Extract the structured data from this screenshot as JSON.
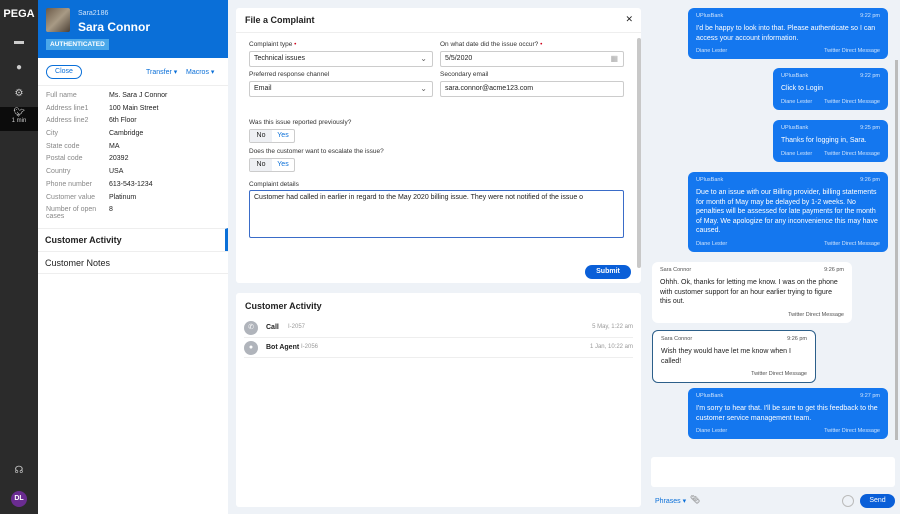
{
  "rail": {
    "logo": "PEGA",
    "active_time": "1 min",
    "avatar_initials": "DL"
  },
  "customer": {
    "handle": "Sara2186",
    "name": "Sara Connor",
    "status": "AUTHENTICATED",
    "close": "Close",
    "transfer": "Transfer",
    "macros": "Macros",
    "fields": [
      {
        "label": "Full name",
        "value": "Ms. Sara J Connor"
      },
      {
        "label": "Address line1",
        "value": "100 Main Street"
      },
      {
        "label": "Address line2",
        "value": "6th Floor"
      },
      {
        "label": "City",
        "value": "Cambridge"
      },
      {
        "label": "State code",
        "value": "MA"
      },
      {
        "label": "Postal code",
        "value": "20392"
      },
      {
        "label": "Country",
        "value": "USA"
      },
      {
        "label": "Phone number",
        "value": "613-543-1234"
      },
      {
        "label": "Customer value",
        "value": "Platinum"
      },
      {
        "label": "Number of open cases",
        "value": "8"
      }
    ],
    "tabs": [
      "Customer Activity",
      "Customer Notes"
    ]
  },
  "complaint": {
    "title": "File a Complaint",
    "type_label": "Complaint type",
    "type_value": "Technical issues",
    "date_label": "On what date did the issue occur?",
    "date_value": "5/5/2020",
    "channel_label": "Preferred response channel",
    "channel_value": "Email",
    "email_label": "Secondary email",
    "email_value": "sara.connor@acme123.com",
    "reported_label": "Was this issue reported previously?",
    "escalate_label": "Does the customer want to escalate the issue?",
    "no": "No",
    "yes": "Yes",
    "details_label": "Complaint details",
    "details_value": "Customer had called in earlier in regard to the May 2020 billing issue. They were not notified of the issue o",
    "submit": "Submit"
  },
  "activity": {
    "title": "Customer Activity",
    "items": [
      {
        "type": "Call",
        "id": "I-2057",
        "time": "5 May, 1:22 am"
      },
      {
        "type": "Bot Agent",
        "id": "I-2056",
        "time": "1 Jan, 10:22 am"
      }
    ]
  },
  "chat": {
    "messages": [
      {
        "from": "UPlusBank",
        "time": "9:22 pm",
        "text": "I'd be happy to look into that. Please authenticate so I can access your account information.",
        "agent": "Diane Lester",
        "channel": "Twitter Direct Message"
      },
      {
        "from": "UPlusBank",
        "time": "9:22 pm",
        "text": "Click to Login",
        "agent": "Diane Lester",
        "channel": "Twitter Direct Message"
      },
      {
        "from": "UPlusBank",
        "time": "9:25 pm",
        "text": "Thanks for logging in, Sara.",
        "agent": "Diane Lester",
        "channel": "Twitter Direct Message"
      },
      {
        "from": "UPlusBank",
        "time": "9:26 pm",
        "text": "Due to an issue with our Billing provider, billing statements for month of May may be delayed by 1-2 weeks. No penalties will be assessed for late payments for the month of May. We apologize for any inconvenience this may have caused.",
        "agent": "Diane Lester",
        "channel": "Twitter Direct Message"
      },
      {
        "from": "Sara Connor",
        "time": "9:26 pm",
        "text": "Ohhh. Ok, thanks for letting me know. I was on the phone with customer support for an hour earlier trying to figure this out.",
        "channel": "Twitter Direct Message"
      },
      {
        "from": "Sara Connor",
        "time": "9:26 pm",
        "text": "Wish they would have let me know when I called!",
        "channel": "Twitter Direct Message"
      },
      {
        "from": "UPlusBank",
        "time": "9:27 pm",
        "text": "I'm sorry to hear that. I'll be sure to get this feedback to the customer service management team.",
        "agent": "Diane Lester",
        "channel": "Twitter Direct Message"
      }
    ],
    "phrases": "Phrases",
    "send": "Send"
  }
}
